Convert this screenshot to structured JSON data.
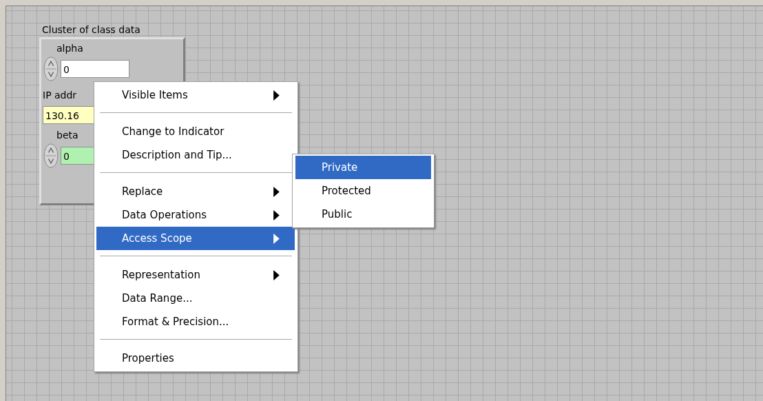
{
  "cluster": {
    "label": "Cluster of class data",
    "controls": [
      {
        "kind": "numeric",
        "label": "alpha",
        "value": "0",
        "color": "#ffffff"
      },
      {
        "kind": "string",
        "label": "IP addr",
        "value": "130.16",
        "color": "#ffffc0"
      },
      {
        "kind": "numeric",
        "label": "beta",
        "value": "0",
        "color": "#b0f0b0"
      }
    ]
  },
  "context_menu": {
    "items": [
      {
        "kind": "item",
        "label": "Visible Items",
        "submenu": true,
        "selected": false
      },
      {
        "kind": "separator"
      },
      {
        "kind": "item",
        "label": "Change to Indicator",
        "submenu": false,
        "selected": false
      },
      {
        "kind": "item",
        "label": "Description and Tip...",
        "submenu": false,
        "selected": false
      },
      {
        "kind": "separator"
      },
      {
        "kind": "item",
        "label": "Replace",
        "submenu": true,
        "selected": false
      },
      {
        "kind": "item",
        "label": "Data Operations",
        "submenu": true,
        "selected": false
      },
      {
        "kind": "item",
        "label": "Access Scope",
        "submenu": true,
        "selected": true
      },
      {
        "kind": "separator"
      },
      {
        "kind": "item",
        "label": "Representation",
        "submenu": true,
        "selected": false
      },
      {
        "kind": "item",
        "label": "Data Range...",
        "submenu": false,
        "selected": false
      },
      {
        "kind": "item",
        "label": "Format & Precision...",
        "submenu": false,
        "selected": false
      },
      {
        "kind": "separator"
      },
      {
        "kind": "item",
        "label": "Properties",
        "submenu": false,
        "selected": false
      }
    ]
  },
  "submenu": {
    "items": [
      {
        "label": "Private",
        "selected": true
      },
      {
        "label": "Protected",
        "selected": false
      },
      {
        "label": "Public",
        "selected": false
      }
    ]
  }
}
